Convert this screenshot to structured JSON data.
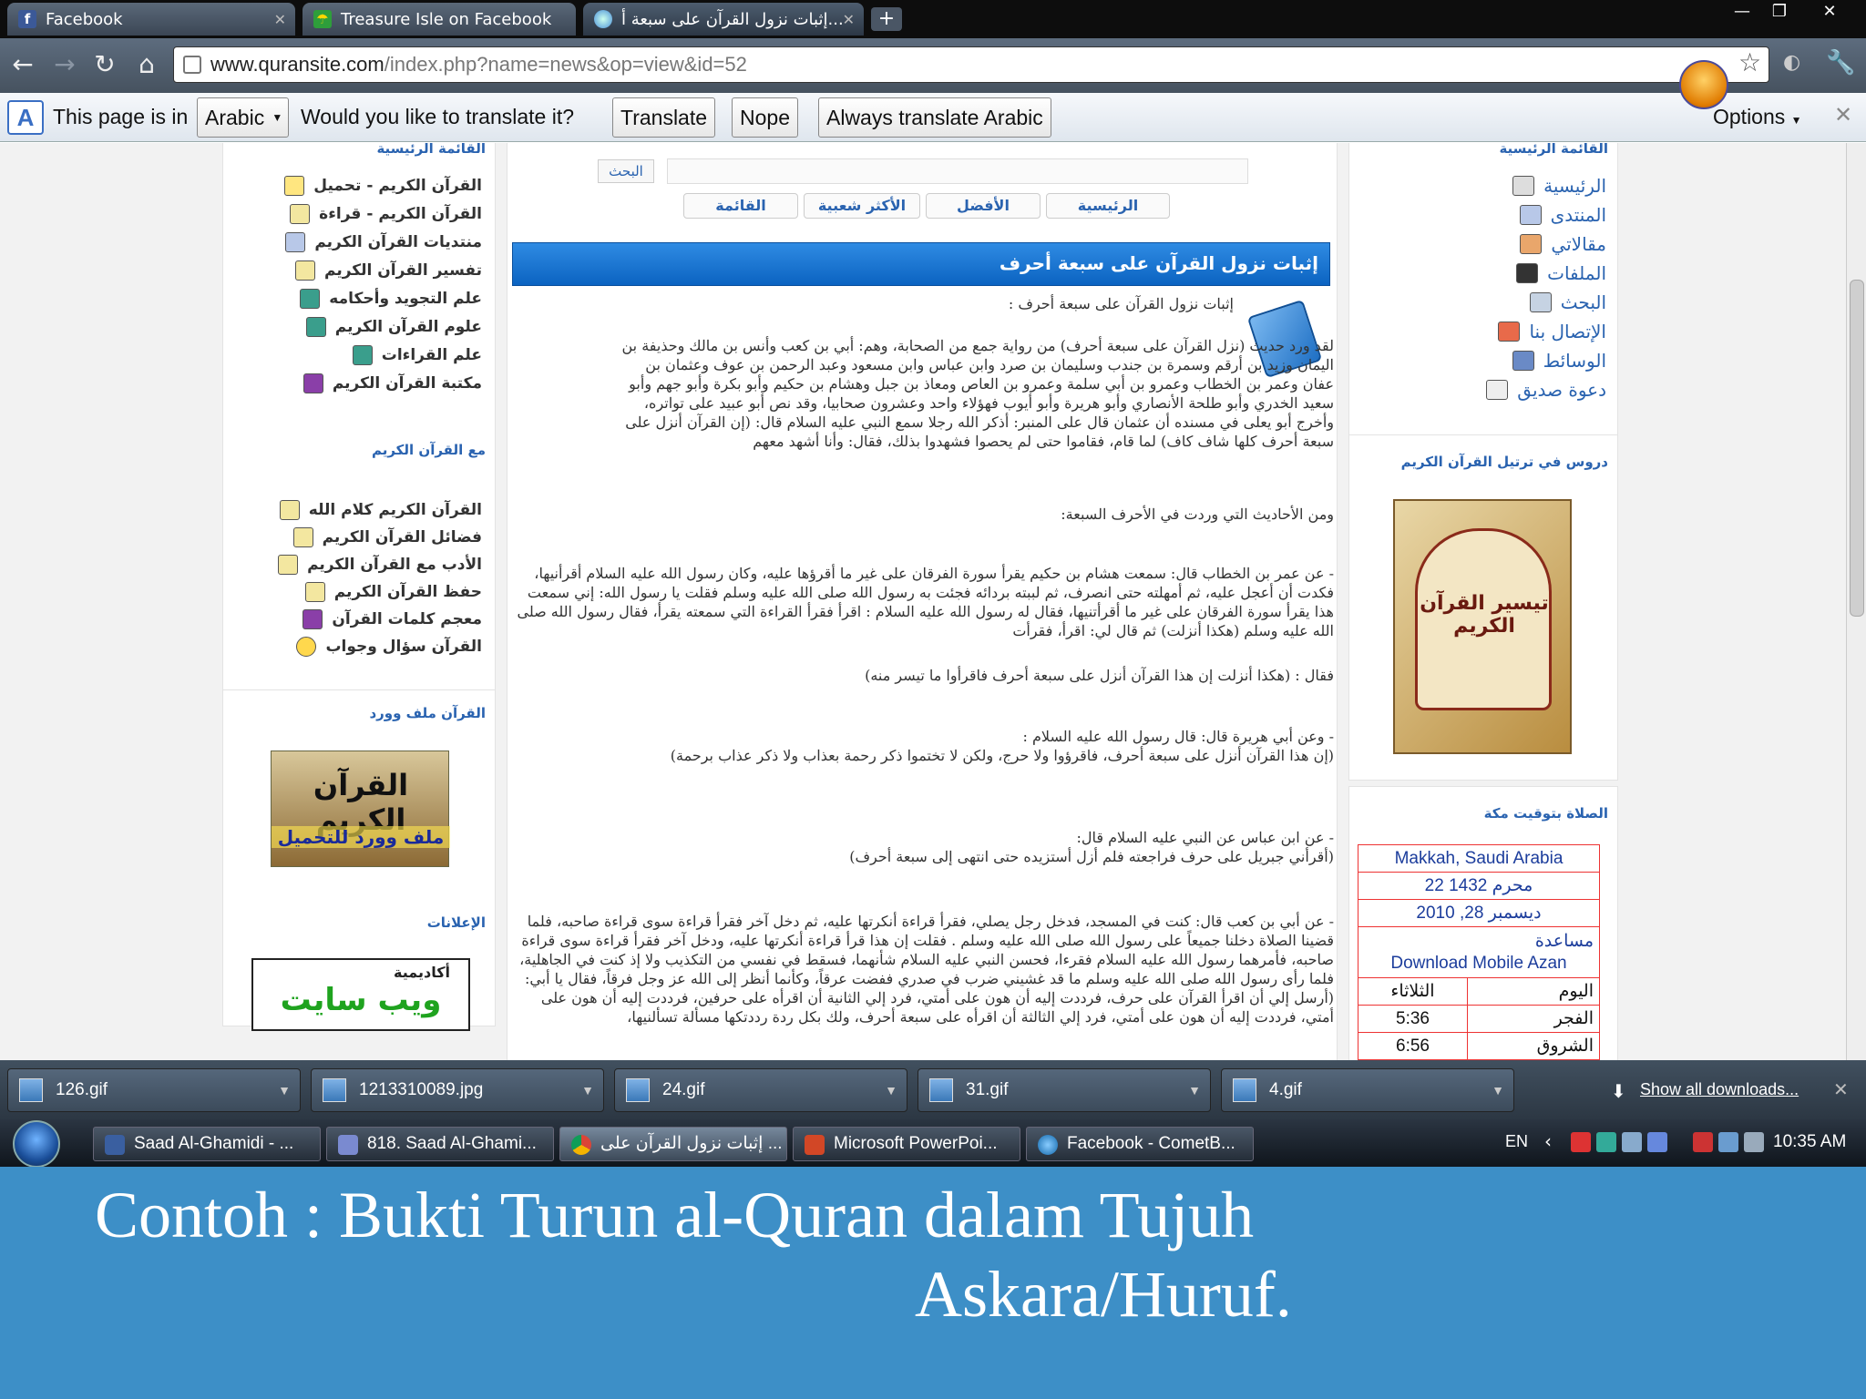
{
  "tabs": [
    {
      "title": "Facebook",
      "icon": "facebook-icon"
    },
    {
      "title": "Treasure Isle on Facebook",
      "icon": "treasure-isle-icon"
    },
    {
      "title": "إثبات نزول القرآن على سبعة أ...",
      "icon": "globe-icon",
      "active": true
    }
  ],
  "window_controls": {
    "minimize": "—",
    "restore": "❐",
    "close": "✕"
  },
  "address": {
    "host": "www.quransite.com",
    "path": "/index.php?name=news&op=view&id=52"
  },
  "translate_bar": {
    "page_is_in": "This page is in",
    "language": "Arabic",
    "question": "Would you like to translate it?",
    "translate": "Translate",
    "nope": "Nope",
    "always": "Always translate Arabic",
    "options": "Options"
  },
  "left_sidebar": {
    "main_menu_header": "القائمة الرئيسية",
    "main_menu": [
      "القرآن الكريم - تحميل",
      "القرآن الكريم - قراءة",
      "منتديات القرآن الكريم",
      "تفسير القرآن الكريم",
      "علم التجويد وأحكامه",
      "علوم القرآن الكريم",
      "علم القراءات",
      "مكتبة القرآن الكريم"
    ],
    "with_quran_header": "مع القرآن الكريم",
    "with_quran": [
      "القرآن الكريم كلام الله",
      "فضائل القرآن الكريم",
      "الأدب مع القرآن الكريم",
      "حفظ القرآن الكريم",
      "معجم كلمات القرآن",
      "القرآن سؤال وجواب"
    ],
    "word_file_header": "القرآن ملف وورد",
    "banner_line1": "القرآن الكريم",
    "banner_line2": "ملف وورد للتحميل",
    "ads_header": "الإعلانات",
    "ad_line1": "أكاديمية",
    "ad_line2": "ويب سايت"
  },
  "center": {
    "search_button": "البحث",
    "nav_tabs": [
      "الرئيسية",
      "الأفضل",
      "الأكثر شعبية",
      "القائمة"
    ],
    "article_title": "إثبات نزول القرآن على سبعة أحرف",
    "paragraphs": [
      "إثبات نزول القرآن على سبعة أحرف :",
      "لقد ورد حديث (نزل القرآن على سبعة أحرف) من رواية جمع من الصحابة، وهم: أبي بن كعب وأنس بن مالك وحذيفة بن اليمان وزيد بن أرقم وسمرة بن جندب وسليمان بن صرد وابن عباس وابن مسعود وعبد الرحمن بن عوف وعثمان بن عفان وعمر بن الخطاب وعمرو بن أبي سلمة وعمرو بن العاص ومعاذ بن جبل وهشام بن حكيم وأبو بكرة وأبو جهم وأبو سعيد الخدري وأبو طلحة الأنصاري وأبو هريرة وأبو أيوب فهؤلاء واحد وعشرون صحابيا، وقد نص أبو عبيد على تواتره، وأخرج أبو يعلى في مسنده أن عثمان قال على المنبر: أذكر الله رجلا سمع النبي عليه السلام قال: (إن القرآن أنزل على سبعة أحرف كلها شاف كاف) لما قام، فقاموا حتى لم يحصوا فشهدوا بذلك، فقال: وأنا أشهد معهم",
      "ومن الأحاديث التي وردت في الأحرف السبعة:",
      "- عن عمر بن الخطاب قال: سمعت هشام بن حكيم يقرأ سورة الفرقان على غير ما أقرؤها عليه، وكان رسول الله عليه السلام أقرأنيها، فكدت أن أعجل عليه، ثم أمهلته حتى انصرف، ثم لببته بردائه فجئت به رسول الله صلى الله عليه وسلم فقلت يا رسول الله: إني سمعت هذا يقرأ سورة الفرقان على غير ما أقرأتنيها، فقال له رسول الله عليه السلام : اقرأ فقرأ القراءة التي سمعته يقرأ، فقال رسول الله صلى الله عليه وسلم (هكذا أنزلت) ثم قال لي: اقرأ، فقرأت",
      "فقال : (هكذا أنزلت إن هذا القرآن أنزل على سبعة أحرف فاقرأوا ما تيسر منه)",
      "- وعن أبي هريرة قال: قال رسول الله عليه السلام :",
      "(إن هذا القرآن أنزل على سبعة أحرف، فاقرؤوا ولا حرج، ولكن لا تختموا ذكر رحمة بعذاب ولا ذكر عذاب برحمة)",
      "- عن ابن عباس عن النبي عليه السلام قال:",
      "(أقرأني جبريل على حرف فراجعته فلم أزل أستزيده حتى انتهى إلى سبعة أحرف)",
      "- عن أبي بن كعب قال: كنت في المسجد، فدخل رجل يصلي، فقرأ قراءة أنكرتها عليه، ثم دخل آخر فقرأ قراءة سوى قراءة صاحبه، فلما قضينا الصلاة دخلنا جميعاً على رسول الله صلى الله عليه وسلم . فقلت إن هذا قرأ قراءة أنكرتها عليه، ودخل آخر فقرأ قراءة سوى قراءة صاحبه، فأمرهما رسول الله عليه السلام فقرءا، فحسن النبي عليه السلام شأنهما، فسقط في نفسي من التكذيب ولا إذ كنت في الجاهلية، فلما رأى رسول الله صلى الله عليه وسلم ما قد غشيني ضرب في صدري ففضت عرقاً، وكأنما أنظر إلى الله عز وجل فرقاً، فقال يا أبي: (أرسل إلي أن اقرأ القرآن على حرف، فرددت إليه أن هون على أمتي، فرد إلي الثانية أن اقرأه على حرفين، فرددت إليه أن هون على أمتي، فرددت إليه أن هون على أمتي، فرد إلي الثالثة أن اقرأه على سبعة أحرف، ولك بكل ردة رددتكها مسألة تسألنيها،"
    ]
  },
  "right_sidebar": {
    "main_menu_header": "القائمة الرئيسية",
    "main_menu": [
      "الرئيسية",
      "المنتدى",
      "مقالاتي",
      "الملفات",
      "البحث",
      "الإتصال بنا",
      "الوسائط",
      "دعوة صديق"
    ],
    "lessons_header": "دروس في ترتيل القرآن الكريم",
    "book_title": "تيسير القرآن الكريم",
    "prayer_header": "الصلاة بتوقيت مكة",
    "prayer": {
      "location": "Makkah, Saudi Arabia",
      "hijri": "22 محرم 1432",
      "gregorian": "ديسمبر 28, 2010",
      "help": "مساعدة",
      "download": "Download Mobile Azan",
      "day_label": "اليوم",
      "day": "الثلاثاء",
      "rows": [
        {
          "name": "الفجر",
          "time": "5:36"
        },
        {
          "name": "الشروق",
          "time": "6:56"
        }
      ]
    }
  },
  "downloads": [
    "126.gif",
    "1213310089.jpg",
    "24.gif",
    "31.gif",
    "4.gif"
  ],
  "show_all_downloads": "Show all downloads...",
  "taskbar": {
    "items": [
      "Saad Al-Ghamidi - ...",
      "818. Saad Al-Ghami...",
      "إثبات نزول القرآن على ...",
      "Microsoft PowerPoi...",
      "Facebook - CometB..."
    ],
    "lang": "EN",
    "time": "10:35 AM"
  },
  "caption": {
    "line1": "Contoh : Bukti Turun al-Quran dalam Tujuh",
    "line2": "Askara/Huruf."
  },
  "colors": {
    "link_blue": "#2a63b0",
    "title_blue": "#0b63c1",
    "slide_blue": "#3d8fc7"
  }
}
